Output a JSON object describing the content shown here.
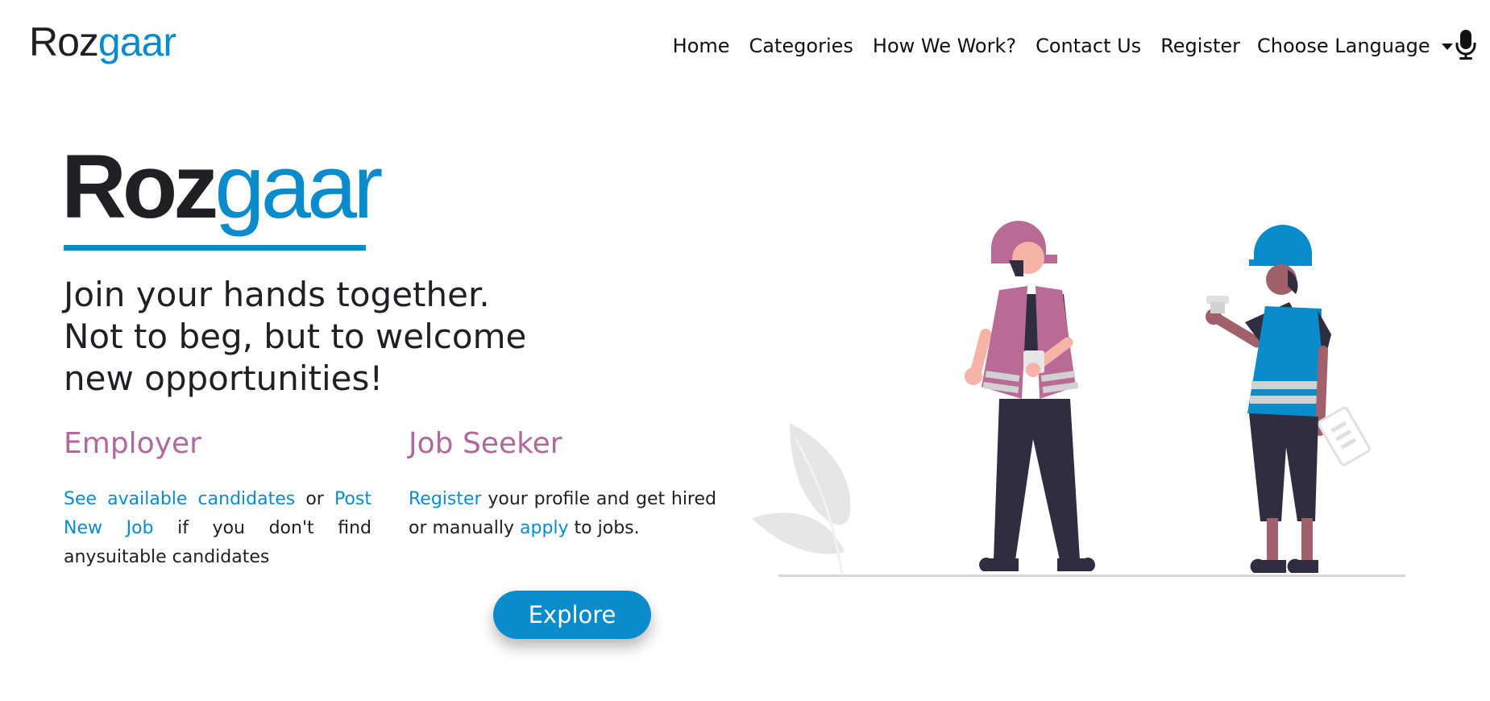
{
  "brand": {
    "prefix": "Roz",
    "accent": "gaar"
  },
  "nav": {
    "links": [
      "Home",
      "Categories",
      "How We Work?",
      "Contact Us",
      "Register"
    ],
    "language_label": "Choose Language",
    "mic_icon": "microphone-icon"
  },
  "hero": {
    "title_prefix": "Roz",
    "title_accent": "gaar",
    "tagline_lines": [
      "Join your hands together.",
      "Not to beg, but to welcome",
      "new opportunities!"
    ]
  },
  "employer": {
    "title": "Employer",
    "link1": "See available candidates",
    "text1": " or ",
    "link2": "Post New Job",
    "text2": " if you don't find anysuitable candidates"
  },
  "seeker": {
    "title": "Job Seeker",
    "link1": "Register",
    "text1": " your profile and get hired or manually ",
    "link2": "apply",
    "text2": " to jobs."
  },
  "explore_label": "Explore",
  "colors": {
    "accent": "#0a8ccc",
    "heading_pink": "#b0699a",
    "dark": "#1f1f24"
  }
}
